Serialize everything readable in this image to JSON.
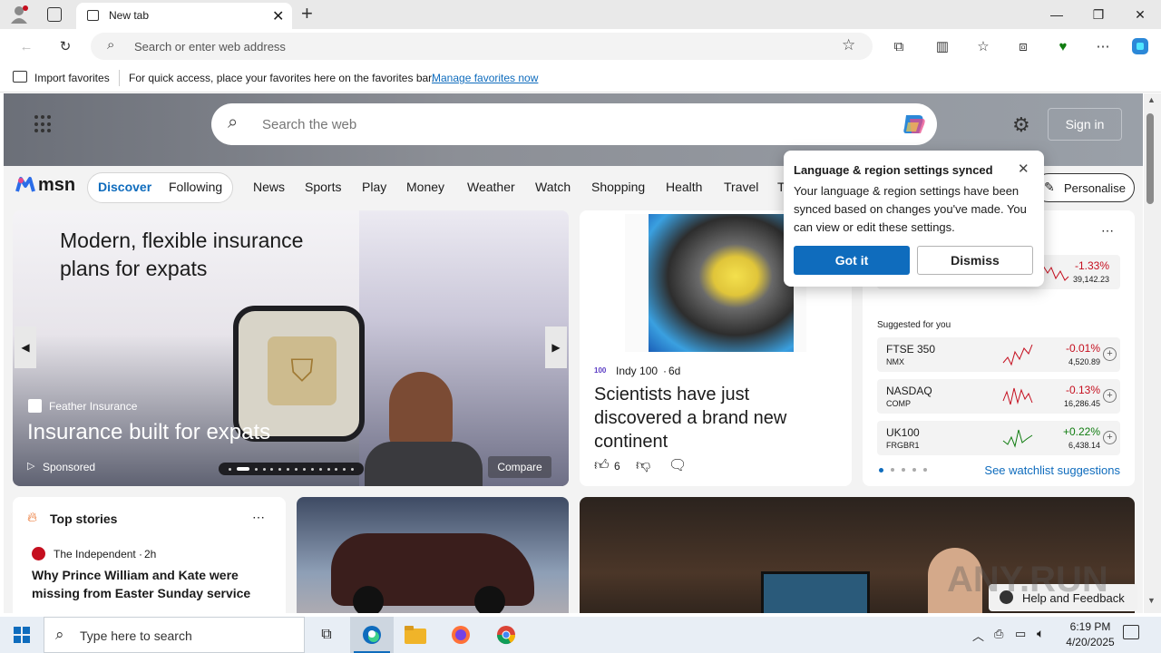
{
  "browser": {
    "tab_title": "New tab",
    "address_placeholder": "Search or enter web address"
  },
  "favorites_bar": {
    "import_label": "Import favorites",
    "hint": "For quick access, place your favorites here on the favorites bar.",
    "manage_link": "Manage favorites now"
  },
  "msn": {
    "search_placeholder": "Search the web",
    "sign_in": "Sign in",
    "logo": "msn",
    "tabs": [
      "Discover",
      "Following"
    ],
    "nav": [
      "News",
      "Sports",
      "Play",
      "Money",
      "Weather",
      "Watch",
      "Shopping",
      "Health",
      "Travel",
      "T"
    ],
    "personalise": "Personalise"
  },
  "hero": {
    "headline": "Modern, flexible insurance plans for expats",
    "brand": "Feather Insurance",
    "title": "Insurance built for expats",
    "sponsored": "Sponsored",
    "compare": "Compare"
  },
  "story": {
    "source": "Indy 100",
    "age": "6d",
    "source_logo": "100",
    "title": "Scientists have just discovered a brand new continent",
    "likes": "6"
  },
  "popup": {
    "title": "Language & region settings synced",
    "body": "Your language & region settings have been synced based on changes you've made. You can view or edit these settings.",
    "got_it": "Got it",
    "dismiss": "Dismiss"
  },
  "watchlist": {
    "top_change": "-1.33%",
    "top_value": "39,142.23",
    "suggested_label": "Suggested for you",
    "items": [
      {
        "name": "FTSE 350",
        "sub": "NMX",
        "change": "-0.01%",
        "value": "4,520.89",
        "color": "#c50f1f"
      },
      {
        "name": "NASDAQ",
        "sub": "COMP",
        "change": "-0.13%",
        "value": "16,286.45",
        "color": "#c50f1f"
      },
      {
        "name": "UK100",
        "sub": "FRGBR1",
        "change": "+0.22%",
        "value": "6,438.14",
        "color": "#107c10"
      }
    ],
    "see_more": "See watchlist suggestions"
  },
  "top_stories": {
    "title": "Top stories",
    "source": "The Independent",
    "age": "2h",
    "headline": "Why Prince William and Kate were missing from Easter Sunday service"
  },
  "help": {
    "label": "Help and Feedback"
  },
  "watermark": "ANY.RUN",
  "taskbar": {
    "search_placeholder": "Type here to search",
    "time": "6:19 PM",
    "date": "4/20/2025"
  },
  "colors": {
    "accent": "#0f6cbd",
    "negative": "#c50f1f",
    "positive": "#107c10"
  }
}
